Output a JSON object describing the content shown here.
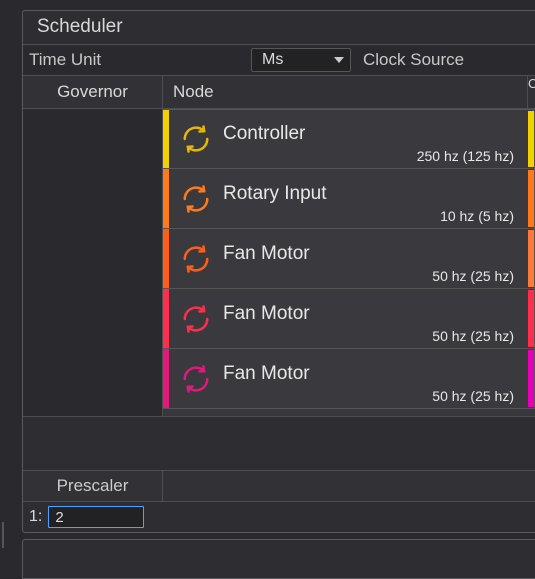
{
  "panel": {
    "title": "Scheduler"
  },
  "settings": {
    "time_unit_label": "Time Unit",
    "time_unit_value": "Ms",
    "clock_source_label": "Clock Source"
  },
  "columns": {
    "governor": "Governor",
    "node": "Node",
    "cut": "C"
  },
  "nodes": [
    {
      "name": "Controller",
      "hz": "250 hz (125 hz)",
      "color": "#e6b800",
      "bar": "#f2d100",
      "side": "#f2d100"
    },
    {
      "name": "Rotary Input",
      "hz": "10 hz (5 hz)",
      "color": "#ff7a1a",
      "bar": "#ff7a1a",
      "side": "#ff7a1a"
    },
    {
      "name": "Fan Motor",
      "hz": "50 hz (25 hz)",
      "color": "#ff5e1a",
      "bar": "#ff5e1a",
      "side": "#ff7a3a"
    },
    {
      "name": "Fan Motor",
      "hz": "50 hz (25 hz)",
      "color": "#ff2e4d",
      "bar": "#ff2e4d",
      "side": "#ff2e4d"
    },
    {
      "name": "Fan Motor",
      "hz": "50 hz (25 hz)",
      "color": "#e0197a",
      "bar": "#e0197a",
      "side": "#e600b8"
    }
  ],
  "prescaler": {
    "label": "Prescaler",
    "index_label": "1:",
    "value": "2"
  }
}
